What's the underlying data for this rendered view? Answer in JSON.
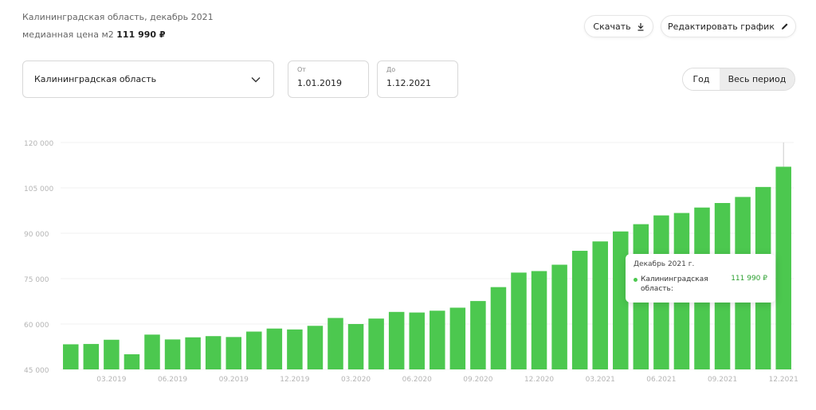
{
  "header": {
    "region_line": "Калининградская область, декабрь 2021",
    "price_label": "медианная цена м2",
    "price_value": "111 990 ₽"
  },
  "toolbar": {
    "download_label": "Скачать",
    "edit_label": "Редактировать график"
  },
  "filters": {
    "region_value": "Калининградская область",
    "date_from_label": "От",
    "date_from_value": "1.01.2019",
    "date_to_label": "До",
    "date_to_value": "1.12.2021"
  },
  "period_toggle": {
    "year_label": "Год",
    "all_label": "Весь период",
    "selected": "Весь период"
  },
  "tooltip": {
    "title": "Декабрь 2021 г.",
    "series_name": "Калининградская область:",
    "value": "111 990 ₽"
  },
  "colors": {
    "bar": "#4cc84f",
    "accent_value": "#2a9f2e"
  },
  "chart_data": {
    "type": "bar",
    "title": "",
    "xlabel": "",
    "ylabel": "",
    "ylim": [
      45000,
      120000
    ],
    "y_ticks": [
      45000,
      60000,
      75000,
      90000,
      105000,
      120000
    ],
    "y_tick_labels": [
      "45 000",
      "60 000",
      "75 000",
      "90 000",
      "105 000",
      "120 000"
    ],
    "x_tick_labels": [
      "03.2019",
      "06.2019",
      "09.2019",
      "12.2019",
      "03.2020",
      "06.2020",
      "09.2020",
      "12.2020",
      "03.2021",
      "06.2021",
      "09.2021",
      "12.2021"
    ],
    "x_tick_positions": [
      2,
      5,
      8,
      11,
      14,
      17,
      20,
      23,
      26,
      29,
      32,
      35
    ],
    "categories": [
      "01.2019",
      "02.2019",
      "03.2019",
      "04.2019",
      "05.2019",
      "06.2019",
      "07.2019",
      "08.2019",
      "09.2019",
      "10.2019",
      "11.2019",
      "12.2019",
      "01.2020",
      "02.2020",
      "03.2020",
      "04.2020",
      "05.2020",
      "06.2020",
      "07.2020",
      "08.2020",
      "09.2020",
      "10.2020",
      "11.2020",
      "12.2020",
      "01.2021",
      "02.2021",
      "03.2021",
      "04.2021",
      "05.2021",
      "06.2021",
      "07.2021",
      "08.2021",
      "09.2021",
      "10.2021",
      "11.2021",
      "12.2021"
    ],
    "series": [
      {
        "values": [
          53300,
          53400,
          54800,
          50000,
          56500,
          54900,
          55600,
          56000,
          55700,
          57500,
          58500,
          58200,
          59400,
          62000,
          60000,
          61800,
          64000,
          63800,
          64400,
          65400,
          67600,
          72200,
          77000,
          77500,
          79600,
          84200,
          87300,
          90600,
          93000,
          95900,
          96700,
          98500,
          100000,
          102000,
          105300,
          111990
        ]
      }
    ],
    "grid": true,
    "legend": "none"
  }
}
